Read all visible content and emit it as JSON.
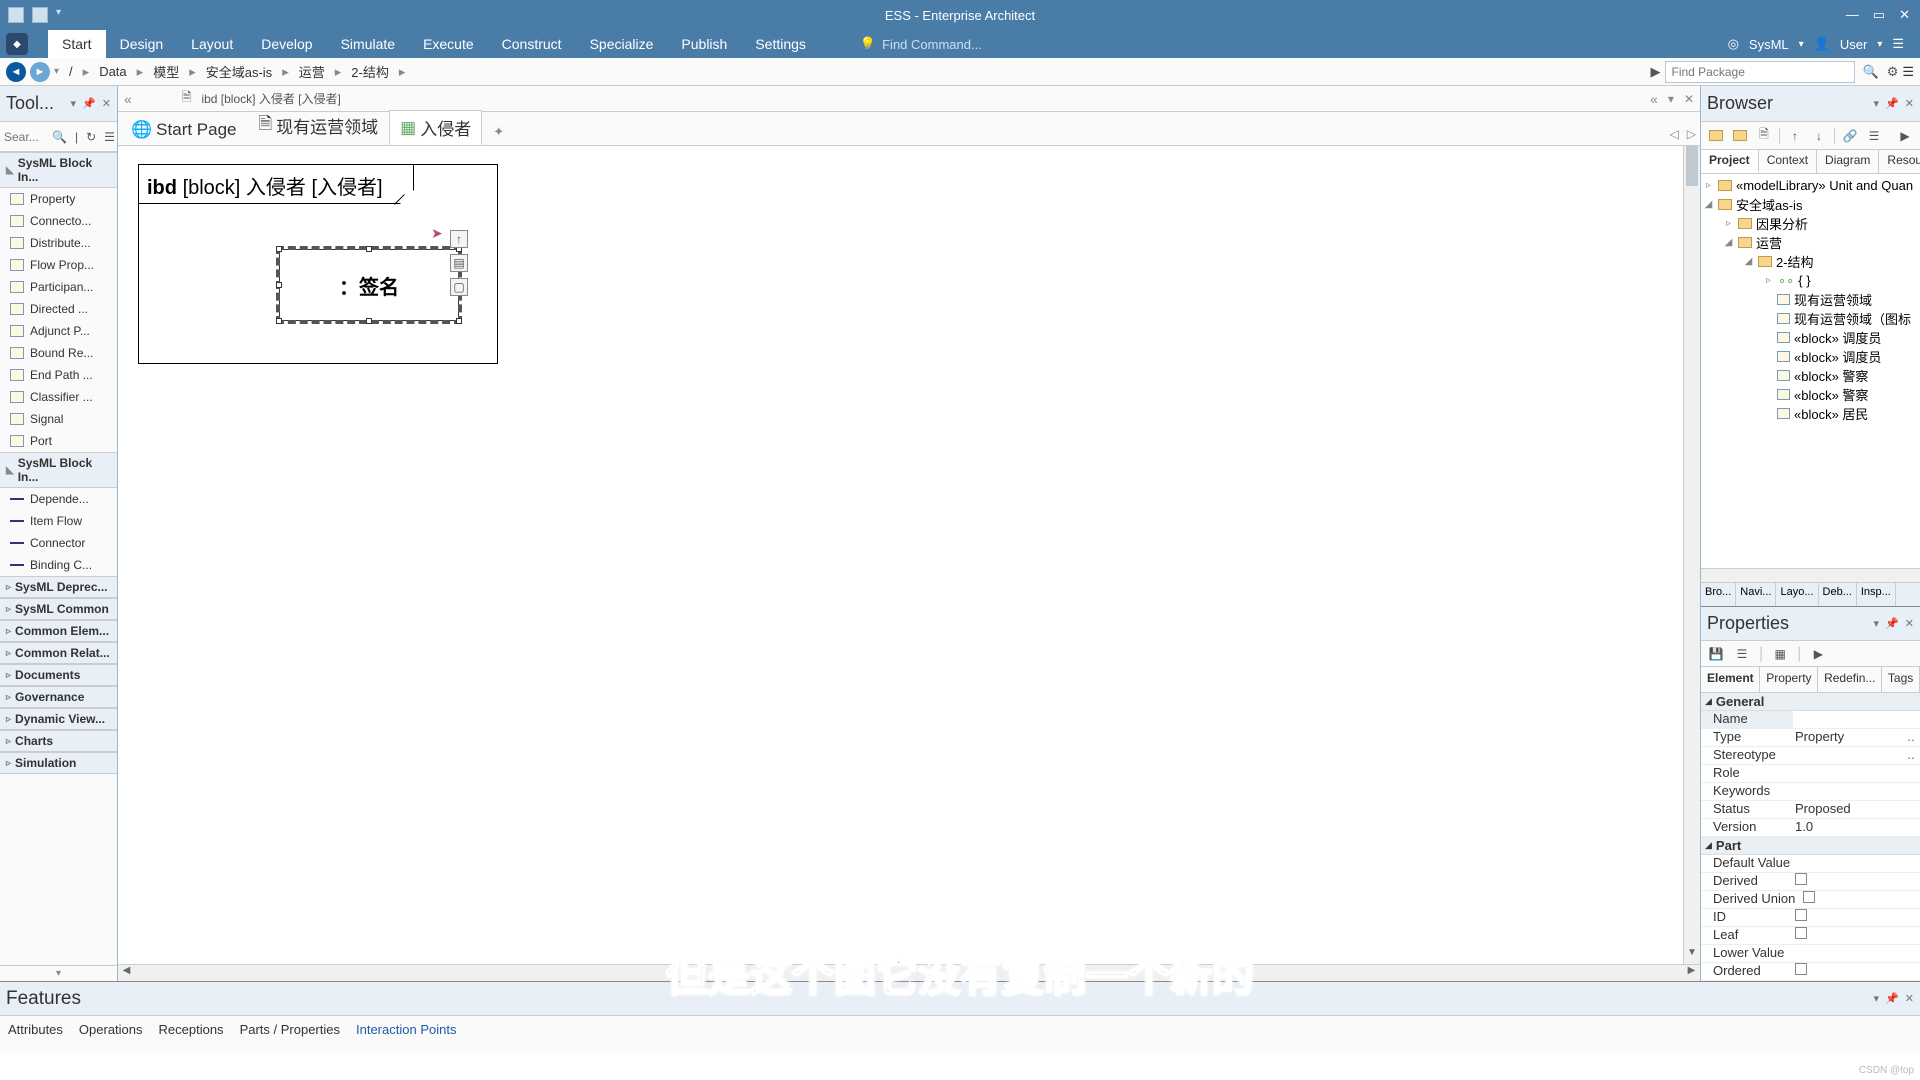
{
  "titlebar": {
    "title": "ESS - Enterprise Architect",
    "min": "—",
    "max": "▭",
    "close": "✕"
  },
  "ribbon": {
    "tabs": [
      "Start",
      "Design",
      "Layout",
      "Develop",
      "Simulate",
      "Execute",
      "Construct",
      "Specialize",
      "Publish",
      "Settings"
    ],
    "find_cmd_placeholder": "Find Command...",
    "perspective": "SysML",
    "user": "User"
  },
  "breadcrumbs": [
    "/",
    "Data",
    "模型",
    "安全域as-is",
    "运营",
    "2-结构"
  ],
  "find_pkg": "Find Package",
  "toolbox": {
    "title": "Tool...",
    "search_placeholder": "Sear...",
    "cat1": "SysML Block In...",
    "items1": [
      "Property",
      "Connecto...",
      "Distribute...",
      "Flow Prop...",
      "Participan...",
      "Directed ...",
      "Adjunct P...",
      "Bound Re...",
      "End Path ...",
      "Classifier ...",
      "Signal",
      "Port"
    ],
    "cat2": "SysML Block In...",
    "items2": [
      "Depende...",
      "Item Flow",
      "Connector",
      "Binding C..."
    ],
    "cats_rest": [
      "SysML Deprec...",
      "SysML Common",
      "Common Elem...",
      "Common Relat...",
      "Documents",
      "Governance",
      "Dynamic View...",
      "Charts",
      "Simulation"
    ]
  },
  "tabstrip": {
    "doc_label": "ibd [block] 入侵者 [入侵者]"
  },
  "doc_tabs": {
    "t1": "Start Page",
    "t2": "现有运营领域",
    "t3": "入侵者"
  },
  "diagram": {
    "frame_prefix": "ibd",
    "frame_mid": "[block] 入侵者 [入侵者]",
    "element_label": "：签名"
  },
  "browser": {
    "title": "Browser",
    "tabs": [
      "Project",
      "Context",
      "Diagram",
      "Resour..."
    ],
    "tree": {
      "n1": "«modelLibrary» Unit and Quan",
      "n2": "安全域as-is",
      "n3": "因果分析",
      "n4": "运营",
      "n5": "2-结构",
      "n6": "{ }",
      "n7": "现有运营领域",
      "n8": "现有运营领域（图标",
      "n9": "«block» 调度员",
      "n10": "«block» 调度员",
      "n11": "«block» 警察",
      "n12": "«block» 警察",
      "n13": "«block» 居民"
    },
    "bottom": [
      "Bro...",
      "Navi...",
      "Layo...",
      "Deb...",
      "Insp..."
    ]
  },
  "properties": {
    "title": "Properties",
    "tabs": [
      "Element",
      "Property",
      "Redefin...",
      "Tags"
    ],
    "sec1": "General",
    "rows": {
      "name_k": "Name",
      "name_v": "",
      "type_k": "Type",
      "type_v": "Property",
      "st_k": "Stereotype",
      "st_v": "",
      "role_k": "Role",
      "role_v": "",
      "kw_k": "Keywords",
      "kw_v": "",
      "status_k": "Status",
      "status_v": "Proposed",
      "ver_k": "Version",
      "ver_v": "1.0"
    },
    "sec2": "Part",
    "rows2": {
      "dv_k": "Default Value",
      "der_k": "Derived",
      "du_k": "Derived Union",
      "id_k": "ID",
      "leaf_k": "Leaf",
      "lv_k": "Lower Value",
      "ord_k": "Ordered"
    }
  },
  "features": {
    "title": "Features",
    "tabs": [
      "Attributes",
      "Operations",
      "Receptions",
      "Parts / Properties",
      "Interaction Points"
    ]
  },
  "subtitle": "但是这个图它没有复制一个新的",
  "watermark": "CSDN @top"
}
